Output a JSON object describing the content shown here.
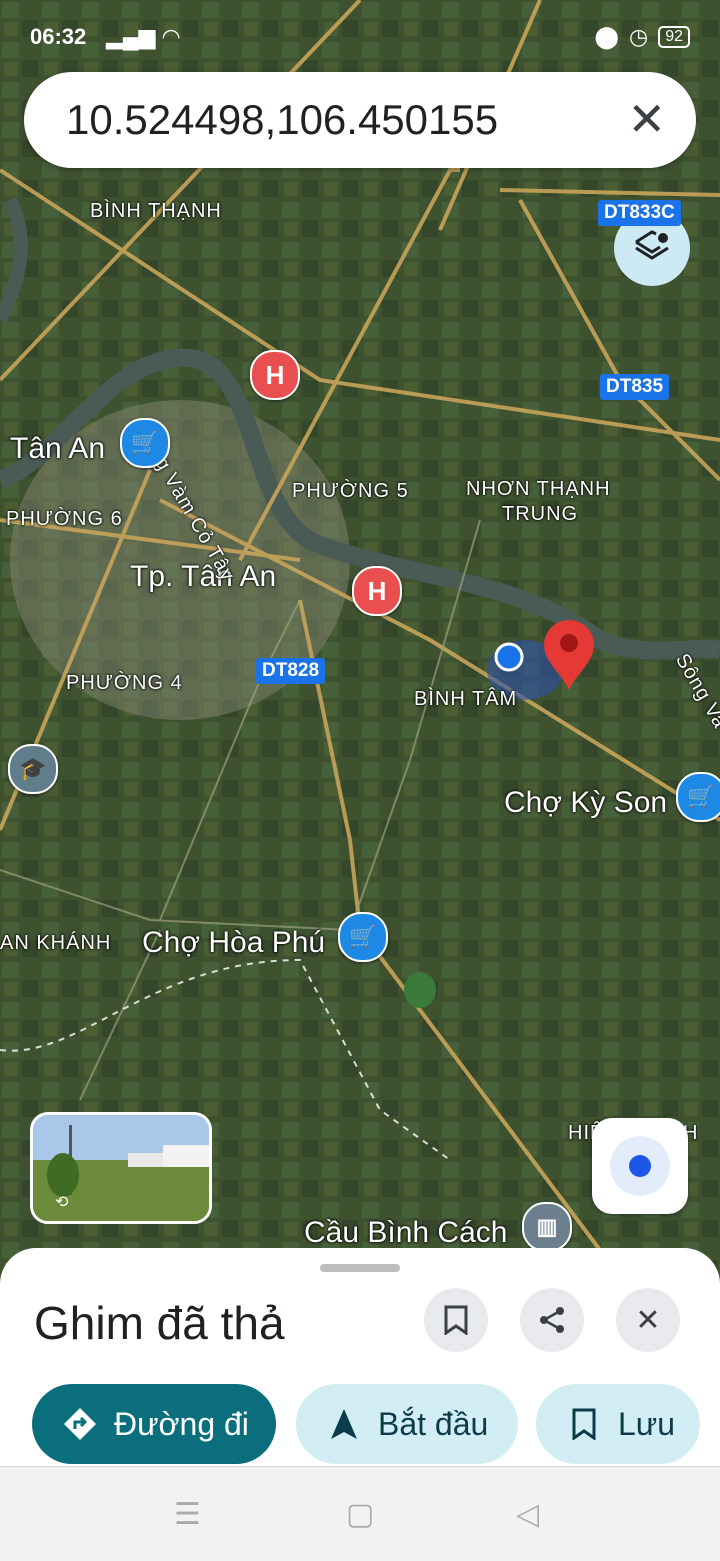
{
  "status_bar": {
    "time": "06:32",
    "battery": "92"
  },
  "search": {
    "value": "10.524498,106.450155",
    "close_icon": "close-icon"
  },
  "map": {
    "place_labels": {
      "binh_thanh": "BÌNH THẠNH",
      "tan_an": "Tân An",
      "phuong_5": "PHƯỜNG 5",
      "nhon_thanh_trung_1": "NHƠN THẠNH",
      "nhon_thanh_trung_2": "TRUNG",
      "phuong_6": "PHƯỜNG 6",
      "tp_tan_an": "Tp. Tân An",
      "phuong_4": "PHƯỜNG 4",
      "binh_tam": "BÌNH TÂM",
      "cho_ky_son": "Chợ Kỳ Son",
      "an_khanh": "AN KHÁNH",
      "cho_hoa_phu": "Chợ Hòa Phú",
      "cau_binh_cach": "Cầu Bình Cách",
      "hiep_thanh": "HIỆP THẠNH",
      "song_vam_co_tay": "Sông Vàm Cỏ Tây",
      "song_va": "Sông Va"
    },
    "road_labels": {
      "dt835": "DT835",
      "dt833c": "DT833C",
      "dt828": "DT828"
    }
  },
  "sheet": {
    "title": "Ghim đã thả",
    "actions": {
      "directions": "Đường đi",
      "start": "Bắt đầu",
      "save": "Lưu"
    }
  },
  "colors": {
    "accent": "#0b6e7d",
    "chip_light": "#d2eef4",
    "pin": "#e53935",
    "my_location": "#1a73e8"
  }
}
